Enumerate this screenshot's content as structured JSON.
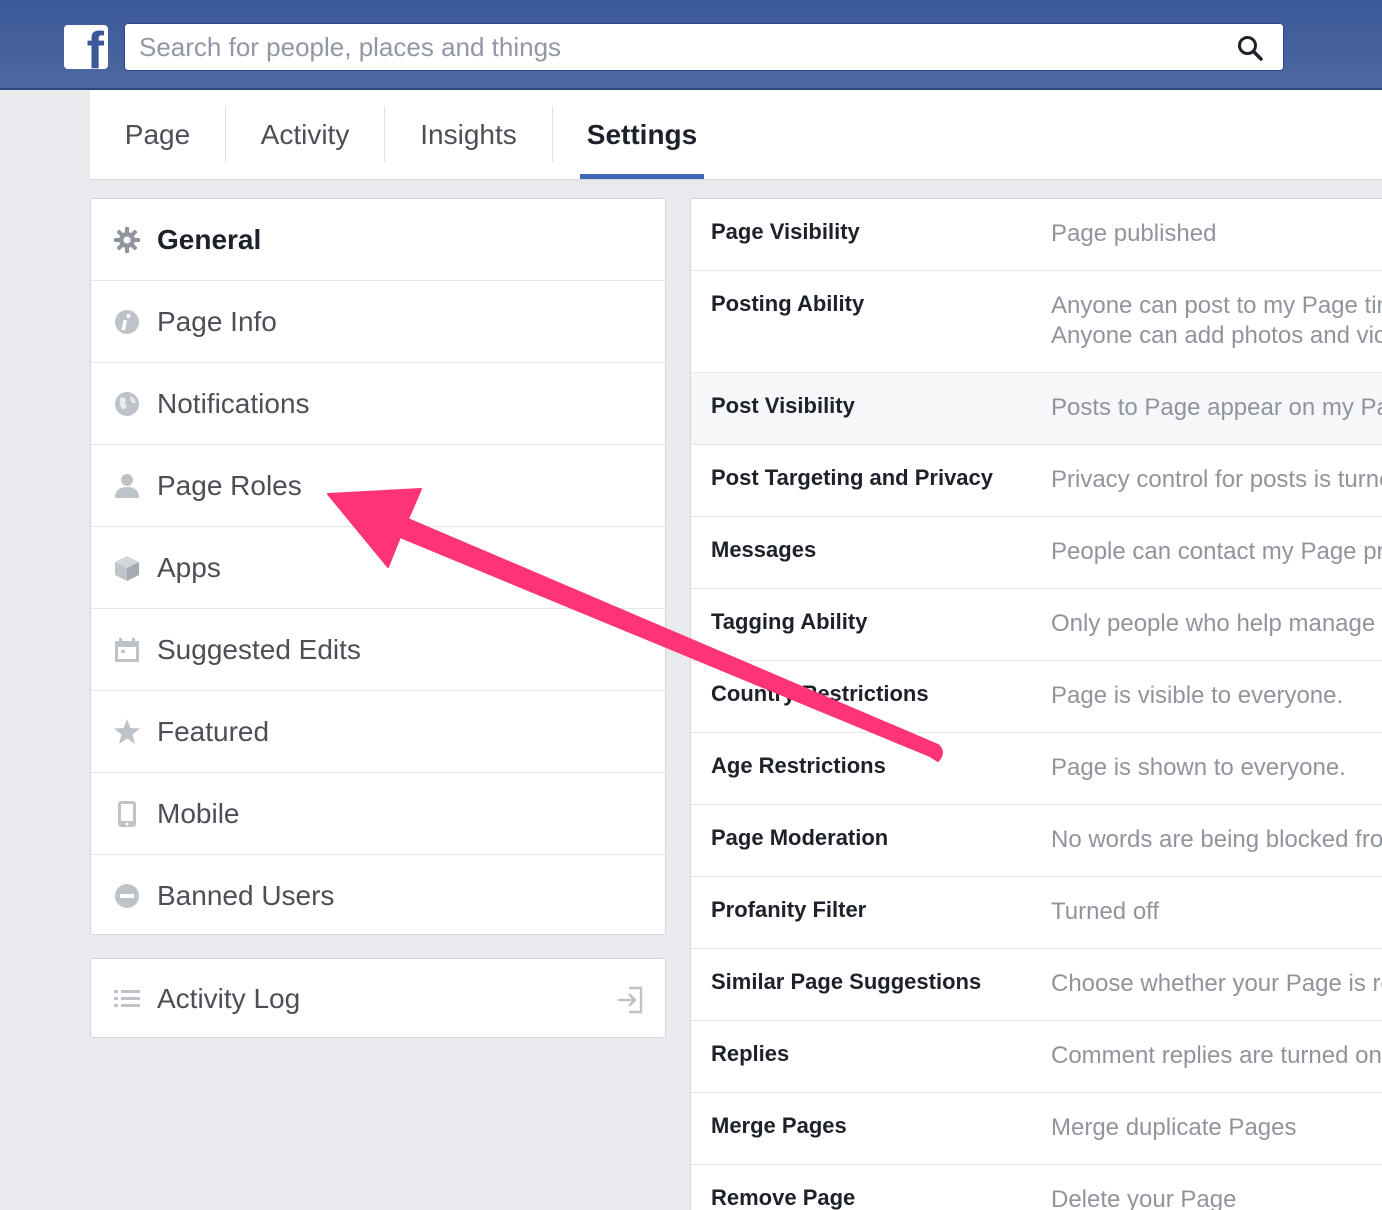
{
  "header": {
    "logo": "f",
    "search_placeholder": "Search for people, places and things"
  },
  "tabs": [
    {
      "label": "Page"
    },
    {
      "label": "Activity"
    },
    {
      "label": "Insights"
    },
    {
      "label": "Settings",
      "active": true
    }
  ],
  "left_menu": {
    "items": [
      {
        "label": "General",
        "icon": "gear-icon",
        "active": true
      },
      {
        "label": "Page Info",
        "icon": "info-icon"
      },
      {
        "label": "Notifications",
        "icon": "globe-icon"
      },
      {
        "label": "Page Roles",
        "icon": "person-icon"
      },
      {
        "label": "Apps",
        "icon": "cube-icon"
      },
      {
        "label": "Suggested Edits",
        "icon": "calendar-icon"
      },
      {
        "label": "Featured",
        "icon": "star-icon"
      },
      {
        "label": "Mobile",
        "icon": "phone-icon"
      },
      {
        "label": "Banned Users",
        "icon": "block-icon"
      }
    ],
    "activity_log": {
      "label": "Activity Log",
      "icon": "list-icon",
      "action_icon": "exit-icon"
    }
  },
  "settings": [
    {
      "label": "Page Visibility",
      "value": "Page published"
    },
    {
      "label": "Posting Ability",
      "value": "Anyone can post to my Page tir",
      "value2": "Anyone can add photos and vic"
    },
    {
      "label": "Post Visibility",
      "value": "Posts to Page appear on my Pa"
    },
    {
      "label": "Post Targeting and Privacy",
      "value": "Privacy control for posts is turne"
    },
    {
      "label": "Messages",
      "value": "People can contact my Page pr"
    },
    {
      "label": "Tagging Ability",
      "value": "Only people who help manage"
    },
    {
      "label": "Country Restrictions",
      "value": "Page is visible to everyone."
    },
    {
      "label": "Age Restrictions",
      "value": "Page is shown to everyone."
    },
    {
      "label": "Page Moderation",
      "value": "No words are being blocked fro"
    },
    {
      "label": "Profanity Filter",
      "value": "Turned off"
    },
    {
      "label": "Similar Page Suggestions",
      "value": "Choose whether your Page is re"
    },
    {
      "label": "Replies",
      "value": "Comment replies are turned on"
    },
    {
      "label": "Merge Pages",
      "value": "Merge duplicate Pages"
    },
    {
      "label": "Remove Page",
      "value": "Delete your Page"
    }
  ],
  "colors": {
    "brand_blue": "#4267b2",
    "annotation_arrow": "#ff3377"
  }
}
